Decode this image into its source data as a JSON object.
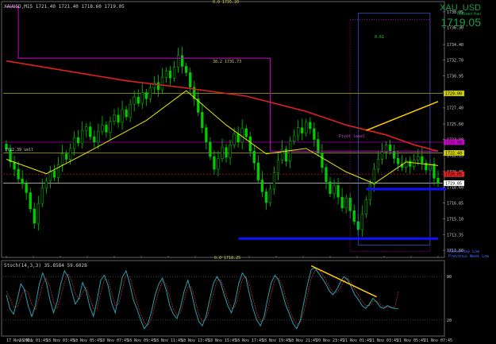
{
  "header": {
    "main": "XAUUSD,M15  1721.40 1721.40 1718.60 1719.05",
    "osc": "Stoch(14,3,3) 35.8584 59.6028"
  },
  "symbol_box": {
    "symbol": "XAU_USD",
    "subtitle": "Indikator Hari",
    "price": "1719.05"
  },
  "annotations": {
    "fib_top": "0.0  1735.20",
    "fib_mid": "38.2  1731.73",
    "fib_bottom": "0.0  1718.25",
    "pivot": "Pivot level",
    "yesterday_low": "Yesterday Low",
    "prev_week_low": "Previous Week Low",
    "left_label": "1722.39  sell",
    "box_label": "0.61"
  },
  "colors": {
    "background": "#000000",
    "candles": "#00cc00",
    "ma_red": "#e02020",
    "ma_yellow": "#e6e600",
    "magenta": "#cc00cc",
    "blue_zone": "#1010ff",
    "trend_yellow": "#ffcc00",
    "stoch_main": "#2a9fb0",
    "stoch_signal": "#cc3333",
    "price_label_bg": "#dd2222",
    "grid": "#333333"
  },
  "chart_data": {
    "type": "candlestick",
    "symbol": "XAUUSD",
    "timeframe": "M15",
    "ylim": [
      1711.0,
      1739.0
    ],
    "price_axis": [
      "1738.05",
      "1736.30",
      "1734.40",
      "1732.70",
      "1730.95",
      "1729.15",
      "1727.40",
      "1725.60",
      "1723.90",
      "1722.15",
      "1720.35",
      "1718.60",
      "1716.85",
      "1715.10",
      "1713.35",
      "1711.60"
    ],
    "time_axis": [
      "17 Nov 2011",
      "18 Nov 01:45",
      "18 Nov 03:45",
      "18 Nov 05:45",
      "18 Nov 07:45",
      "18 Nov 09:45",
      "18 Nov 11:45",
      "18 Nov 13:45",
      "18 Nov 15:45",
      "18 Nov 17:45",
      "18 Nov 19:45",
      "18 Nov 21:45",
      "20 Nov 23:45",
      "21 Nov 01:45",
      "21 Nov 03:45",
      "21 Nov 05:45",
      "21 Nov 07:45"
    ],
    "price_labels": [
      {
        "text": "1729.00",
        "price": 1729.0,
        "color": "#cccc00"
      },
      {
        "text": "1723.60",
        "price": 1723.6,
        "color": "#cc00cc"
      },
      {
        "text": "1722.40",
        "price": 1722.4,
        "color": "#cccc00"
      },
      {
        "text": "1720.05",
        "price": 1720.05,
        "color": "#dd2222"
      },
      {
        "text": "1719.05",
        "price": 1719.05,
        "color": "#ffffff"
      }
    ],
    "closes": [
      1722.8,
      1721.4,
      1720.6,
      1719.5,
      1719.0,
      1718.0,
      1716.2,
      1714.6,
      1716.8,
      1718.5,
      1719.3,
      1720.4,
      1719.7,
      1721.1,
      1722.3,
      1721.7,
      1722.9,
      1724.1,
      1723.5,
      1724.9,
      1725.3,
      1724.2,
      1723.6,
      1724.8,
      1725.5,
      1724.7,
      1725.9,
      1726.6,
      1725.8,
      1727.2,
      1726.4,
      1727.8,
      1728.6,
      1727.9,
      1729.1,
      1728.4,
      1729.6,
      1730.2,
      1729.4,
      1730.8,
      1731.5,
      1730.7,
      1731.9,
      1733.2,
      1732.0,
      1731.3,
      1729.7,
      1728.4,
      1726.9,
      1725.2,
      1723.6,
      1722.0,
      1720.6,
      1721.8,
      1723.0,
      1721.9,
      1723.3,
      1724.5,
      1723.6,
      1725.1,
      1724.2,
      1722.6,
      1721.3,
      1719.4,
      1718.1,
      1716.9,
      1718.4,
      1720.2,
      1721.6,
      1722.8,
      1721.5,
      1723.7,
      1724.3,
      1725.2,
      1724.6,
      1725.8,
      1725.1,
      1723.9,
      1722.4,
      1720.8,
      1719.2,
      1717.9,
      1718.8,
      1717.5,
      1716.3,
      1717.4,
      1716.0,
      1714.8,
      1713.9,
      1715.6,
      1717.2,
      1718.9,
      1720.6,
      1721.7,
      1722.5,
      1723.3,
      1722.6,
      1721.8,
      1721.2,
      1720.8,
      1721.5,
      1720.9,
      1721.6,
      1722.0,
      1721.3,
      1720.5,
      1721.2,
      1719.6,
      1719.05
    ],
    "indicators": {
      "ma_red_points": [
        [
          0,
          1732.6
        ],
        [
          15,
          1731.5
        ],
        [
          30,
          1730.4
        ],
        [
          45,
          1729.6
        ],
        [
          60,
          1728.7
        ],
        [
          75,
          1727.0
        ],
        [
          85,
          1725.5
        ],
        [
          95,
          1724.4
        ],
        [
          102,
          1723.3
        ],
        [
          108,
          1722.6
        ]
      ],
      "ma_yellow_points": [
        [
          0,
          1721.7
        ],
        [
          10,
          1720.1
        ],
        [
          20,
          1722.4
        ],
        [
          35,
          1726.0
        ],
        [
          45,
          1729.3
        ],
        [
          55,
          1725.5
        ],
        [
          65,
          1722.3
        ],
        [
          75,
          1722.9
        ],
        [
          85,
          1720.3
        ],
        [
          92,
          1719.0
        ],
        [
          100,
          1721.4
        ],
        [
          108,
          1721.0
        ]
      ],
      "magenta_step": [
        [
          0,
          1738.6
        ],
        [
          3,
          1738.6
        ],
        [
          3,
          1732.9
        ],
        [
          66,
          1732.9
        ],
        [
          66,
          1722.6
        ],
        [
          108,
          1722.6
        ]
      ],
      "blue_zones": [
        [
          62,
          108,
          1712.9
        ],
        [
          94,
          110,
          1718.4
        ]
      ]
    },
    "oscillator": {
      "name": "Stoch(14,3,3)",
      "main": 35.8584,
      "signal": 59.6028,
      "levels": [
        80,
        20
      ],
      "ylim": [
        0,
        100
      ],
      "series_main": [
        55,
        35,
        28,
        48,
        70,
        62,
        40,
        25,
        40,
        68,
        85,
        72,
        48,
        30,
        45,
        70,
        88,
        80,
        60,
        42,
        50,
        72,
        60,
        38,
        25,
        48,
        75,
        82,
        68,
        44,
        30,
        55,
        80,
        88,
        70,
        48,
        35,
        20,
        8,
        15,
        32,
        55,
        70,
        78,
        62,
        40,
        28,
        22,
        38,
        60,
        75,
        58,
        35,
        18,
        12,
        25,
        48,
        70,
        80,
        72,
        55,
        40,
        30,
        45,
        70,
        85,
        78,
        55,
        35,
        20,
        12,
        25,
        50,
        72,
        82,
        75,
        58,
        40,
        28,
        15,
        8,
        20,
        45,
        70,
        90,
        92,
        85,
        78,
        70,
        60,
        55,
        62,
        72,
        80,
        76,
        66,
        55,
        48,
        40,
        36,
        42,
        50,
        45,
        38,
        36,
        40,
        37,
        36,
        35.86
      ],
      "series_signal": [
        60,
        50,
        38,
        38,
        52,
        62,
        58,
        42,
        34,
        50,
        70,
        78,
        66,
        45,
        36,
        52,
        72,
        84,
        74,
        56,
        48,
        58,
        66,
        50,
        36,
        36,
        58,
        76,
        76,
        58,
        40,
        42,
        64,
        82,
        80,
        62,
        44,
        28,
        16,
        12,
        22,
        42,
        60,
        74,
        70,
        52,
        36,
        26,
        30,
        48,
        66,
        66,
        48,
        28,
        18,
        20,
        36,
        56,
        74,
        76,
        64,
        48,
        36,
        38,
        56,
        76,
        80,
        68,
        48,
        30,
        18,
        20,
        36,
        58,
        76,
        78,
        68,
        50,
        34,
        22,
        14,
        16,
        32,
        56,
        78,
        88,
        90,
        84,
        76,
        66,
        58,
        58,
        64,
        74,
        78,
        72,
        62,
        54,
        46,
        40,
        40,
        46,
        46,
        42,
        38,
        38,
        38,
        37,
        59.6
      ]
    }
  }
}
